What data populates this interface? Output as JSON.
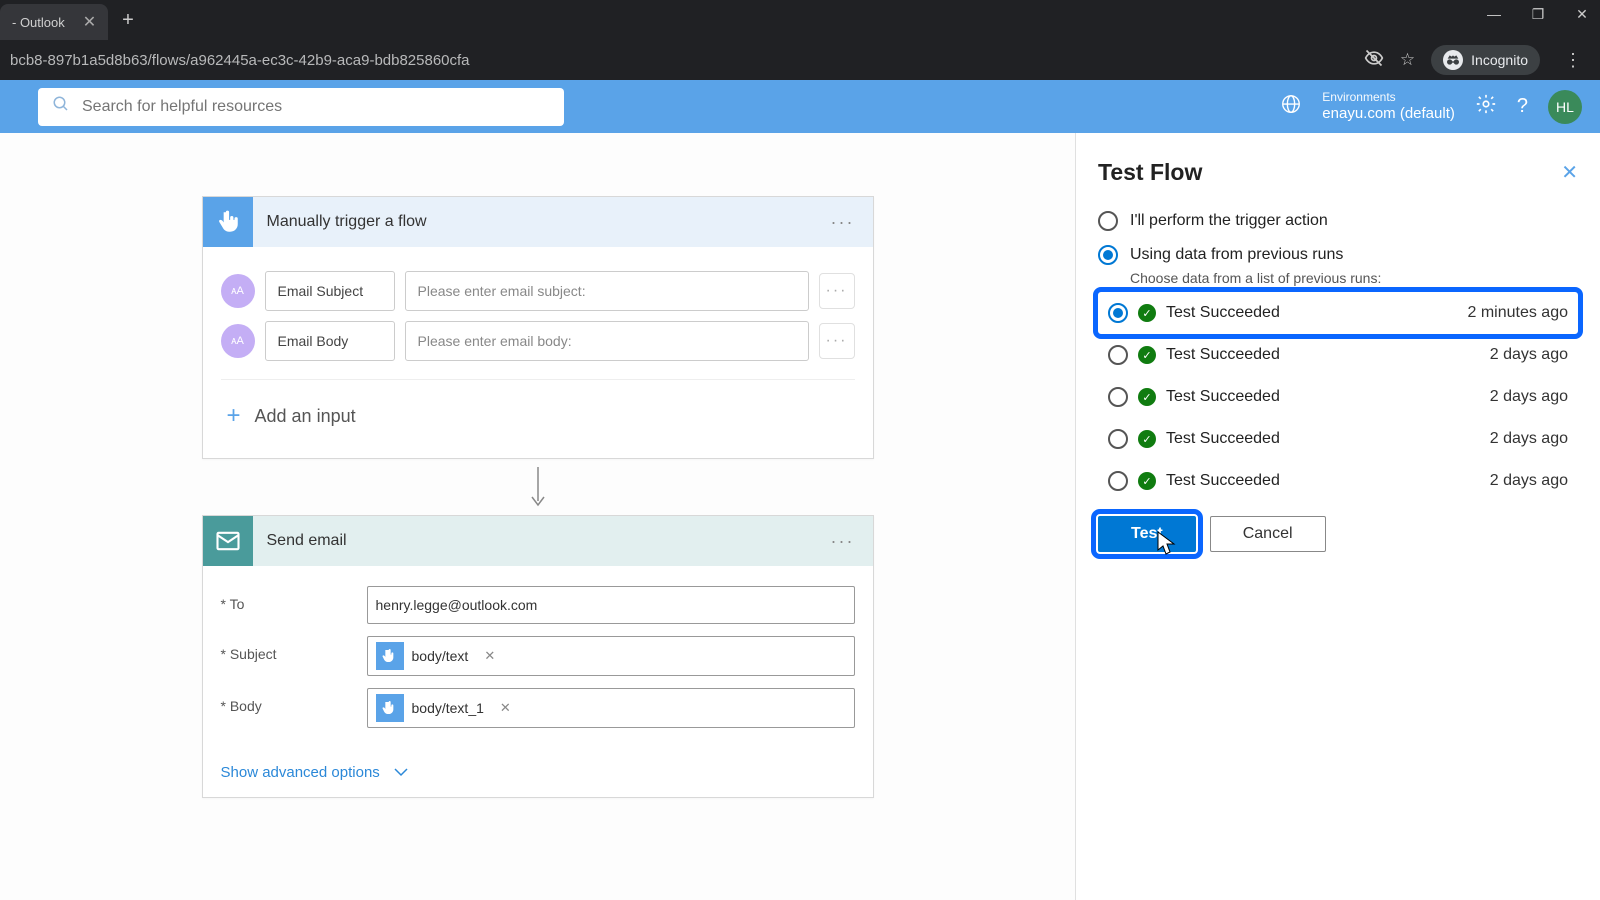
{
  "browser": {
    "tab_title": " - Outlook",
    "url": "bcb8-897b1a5d8b63/flows/a962445a-ec3c-42b9-aca9-bdb825860cfa",
    "incognito_label": "Incognito"
  },
  "header": {
    "search_placeholder": "Search for helpful resources",
    "env_label": "Environments",
    "env_value": "enayu.com (default)",
    "avatar_initials": "HL"
  },
  "trigger_card": {
    "title": "Manually trigger a flow",
    "inputs": [
      {
        "label": "Email Subject",
        "placeholder": "Please enter email subject:"
      },
      {
        "label": "Email Body",
        "placeholder": "Please enter email body:"
      }
    ],
    "add_input": "Add an input"
  },
  "action_card": {
    "title": "Send email",
    "fields": {
      "to_label": "* To",
      "to_value": "henry.legge@outlook.com",
      "subject_label": "* Subject",
      "subject_token": "body/text",
      "body_label": "* Body",
      "body_token": "body/text_1"
    },
    "advanced": "Show advanced options"
  },
  "panel": {
    "title": "Test Flow",
    "opt_manual": "I'll perform the trigger action",
    "opt_previous": "Using data from previous runs",
    "hint": "Choose data from a list of previous runs:",
    "runs": [
      {
        "status": "Test Succeeded",
        "time": "2 minutes ago",
        "selected": true,
        "highlighted": true
      },
      {
        "status": "Test Succeeded",
        "time": "2 days ago",
        "selected": false,
        "highlighted": false
      },
      {
        "status": "Test Succeeded",
        "time": "2 days ago",
        "selected": false,
        "highlighted": false
      },
      {
        "status": "Test Succeeded",
        "time": "2 days ago",
        "selected": false,
        "highlighted": false
      },
      {
        "status": "Test Succeeded",
        "time": "2 days ago",
        "selected": false,
        "highlighted": false
      }
    ],
    "test_btn": "Test",
    "cancel_btn": "Cancel"
  }
}
